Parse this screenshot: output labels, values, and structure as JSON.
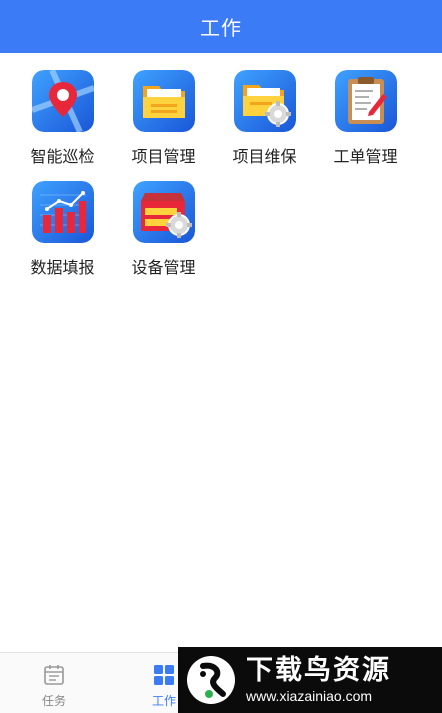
{
  "header": {
    "title": "工作"
  },
  "apps": [
    {
      "label": "智能巡检",
      "icon": "map-pin-icon"
    },
    {
      "label": "项目管理",
      "icon": "folder-icon"
    },
    {
      "label": "项目维保",
      "icon": "folder-gear-icon"
    },
    {
      "label": "工单管理",
      "icon": "clipboard-pencil-icon"
    },
    {
      "label": "数据填报",
      "icon": "bar-chart-icon"
    },
    {
      "label": "设备管理",
      "icon": "drawer-gear-icon"
    }
  ],
  "tabbar": {
    "tabs": [
      {
        "label": "任务",
        "icon": "calendar-icon",
        "active": false
      },
      {
        "label": "工作",
        "icon": "grid-icon",
        "active": true
      }
    ]
  },
  "watermark": {
    "title": "下载鸟资源",
    "url": "www.xiazainiao.com"
  },
  "colors": {
    "primary": "#3b7cf6",
    "tab_inactive": "#888888"
  }
}
